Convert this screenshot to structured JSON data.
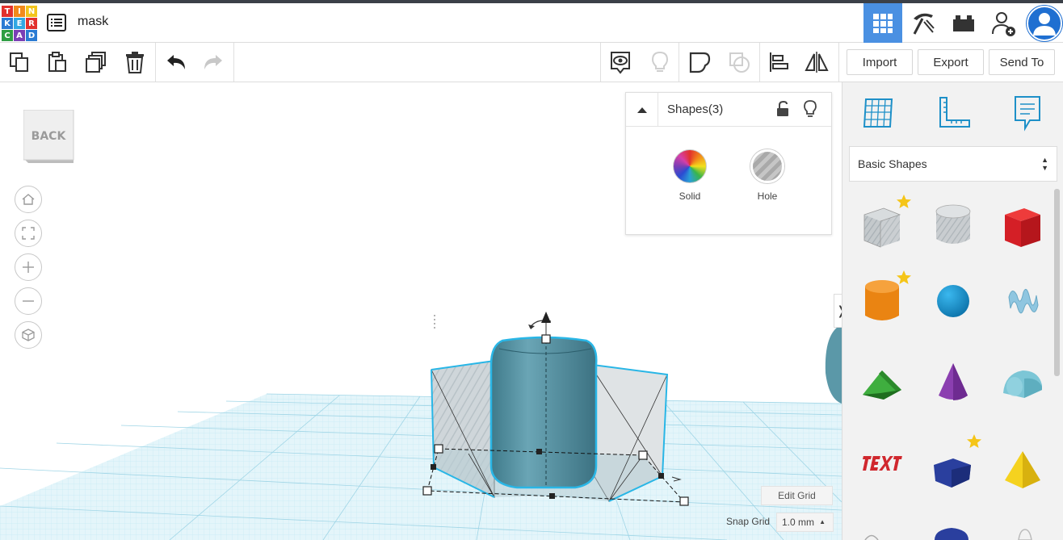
{
  "app": {
    "logo_letters": [
      "T",
      "I",
      "N",
      "K",
      "E",
      "R",
      "C",
      "A",
      "D"
    ],
    "logo_colors": [
      "#e2312d",
      "#f28a1b",
      "#f2c41c",
      "#2a7bd3",
      "#31a8e3",
      "#e2312d",
      "#2f9e44",
      "#7a3fb5",
      "#2a7bd3"
    ],
    "project_name": "mask"
  },
  "header": {
    "buttons": [
      {
        "name": "3d-design-view",
        "icon": "grid-icon",
        "active": true
      },
      {
        "name": "codeblocks-view",
        "icon": "pickaxe-icon",
        "active": false
      },
      {
        "name": "lego-bricks-view",
        "icon": "bricks-icon",
        "active": false
      },
      {
        "name": "invite-collaborator",
        "icon": "add-user-icon",
        "active": false
      }
    ]
  },
  "toolbar": {
    "tools": [
      {
        "name": "copy",
        "icon": "copy-icon"
      },
      {
        "name": "paste",
        "icon": "paste-icon"
      },
      {
        "name": "duplicate",
        "icon": "duplicate-icon"
      },
      {
        "name": "delete",
        "icon": "trash-icon"
      },
      {
        "name": "undo",
        "icon": "undo-icon"
      },
      {
        "name": "redo",
        "icon": "redo-icon"
      },
      {
        "name": "show-all",
        "icon": "eye-bubble-icon"
      },
      {
        "name": "toggle-visibility",
        "icon": "lightbulb-icon"
      },
      {
        "name": "group",
        "icon": "group-icon"
      },
      {
        "name": "ungroup",
        "icon": "ungroup-icon"
      },
      {
        "name": "align",
        "icon": "align-icon"
      },
      {
        "name": "mirror",
        "icon": "mirror-icon"
      }
    ],
    "import_label": "Import",
    "export_label": "Export",
    "send_to_label": "Send To"
  },
  "viewcube": {
    "label": "BACK"
  },
  "view_controls": [
    {
      "name": "home",
      "icon": "home-icon"
    },
    {
      "name": "fit",
      "icon": "fit-view-icon"
    },
    {
      "name": "zoom-in",
      "icon": "plus-icon"
    },
    {
      "name": "zoom-out",
      "icon": "minus-icon"
    },
    {
      "name": "perspective",
      "icon": "cube-icon"
    }
  ],
  "shapes_panel": {
    "title": "Shapes(3)",
    "solid_label": "Solid",
    "hole_label": "Hole"
  },
  "workplane": {
    "edit_grid_label": "Edit Grid",
    "snap_grid_label": "Snap Grid",
    "snap_grid_value": "1.0 mm"
  },
  "right_panel": {
    "top_icons": [
      "workplane-icon",
      "ruler-icon",
      "notes-icon"
    ],
    "category": "Basic Shapes",
    "shapes": [
      {
        "name": "box-hole",
        "icon": "box-hole-icon",
        "starred": true
      },
      {
        "name": "cylinder-hole",
        "icon": "cylinder-hole-icon",
        "starred": false
      },
      {
        "name": "box",
        "icon": "box-icon",
        "starred": false
      },
      {
        "name": "cylinder",
        "icon": "cylinder-icon",
        "starred": true
      },
      {
        "name": "sphere",
        "icon": "sphere-icon",
        "starred": false
      },
      {
        "name": "scribble",
        "icon": "scribble-icon",
        "starred": false
      },
      {
        "name": "roof",
        "icon": "roof-icon",
        "starred": false
      },
      {
        "name": "cone",
        "icon": "cone-icon",
        "starred": false
      },
      {
        "name": "round-roof",
        "icon": "round-roof-icon",
        "starred": false
      },
      {
        "name": "text",
        "icon": "text-icon",
        "starred": false
      },
      {
        "name": "polygon",
        "icon": "polygon-icon",
        "starred": true
      },
      {
        "name": "pyramid",
        "icon": "pyramid-icon",
        "starred": false
      }
    ]
  },
  "colors": {
    "accent": "#4a90e2",
    "selection": "#29b6e6",
    "grid": "#bfe6f2",
    "solid_shape": "#5b98a8"
  }
}
